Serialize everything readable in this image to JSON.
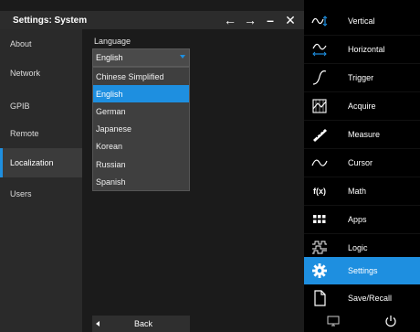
{
  "window": {
    "title": "Settings: System",
    "controls": {
      "back": "←",
      "forward": "→",
      "minimize": "–",
      "close": "✕"
    }
  },
  "sidebar": {
    "items": [
      {
        "label": "About",
        "active": false
      },
      {
        "label": "Network",
        "active": false
      },
      {
        "label": "GPIB",
        "active": false
      },
      {
        "label": "Remote",
        "active": false
      },
      {
        "label": "Localization",
        "active": true
      },
      {
        "label": "Users",
        "active": false
      }
    ]
  },
  "localization": {
    "language_label": "Language",
    "selected_value": "English",
    "options": [
      "Chinese Simplified",
      "English",
      "German",
      "Japanese",
      "Korean",
      "Russian",
      "Spanish"
    ],
    "highlighted": "English"
  },
  "footer": {
    "back_label": "Back"
  },
  "right_panel": {
    "items": [
      {
        "label": "Vertical",
        "icon": "vertical-wave-icon"
      },
      {
        "label": "Horizontal",
        "icon": "horizontal-wave-icon"
      },
      {
        "label": "Trigger",
        "icon": "trigger-icon"
      },
      {
        "label": "Acquire",
        "icon": "acquire-icon"
      },
      {
        "label": "Measure",
        "icon": "measure-ruler-icon"
      },
      {
        "label": "Cursor",
        "icon": "cursor-wave-icon"
      },
      {
        "label": "Math",
        "icon": "math-fx-icon"
      },
      {
        "label": "Apps",
        "icon": "apps-grid-icon"
      },
      {
        "label": "Logic",
        "icon": "logic-icon"
      },
      {
        "label": "Settings",
        "icon": "gear-icon"
      },
      {
        "label": "Save/Recall",
        "icon": "document-icon"
      }
    ],
    "active": "Settings",
    "math_icon_text": "f(x)"
  },
  "colors": {
    "accent": "#1e8fe0",
    "background": "#1b1b1b",
    "panel": "#000000"
  }
}
